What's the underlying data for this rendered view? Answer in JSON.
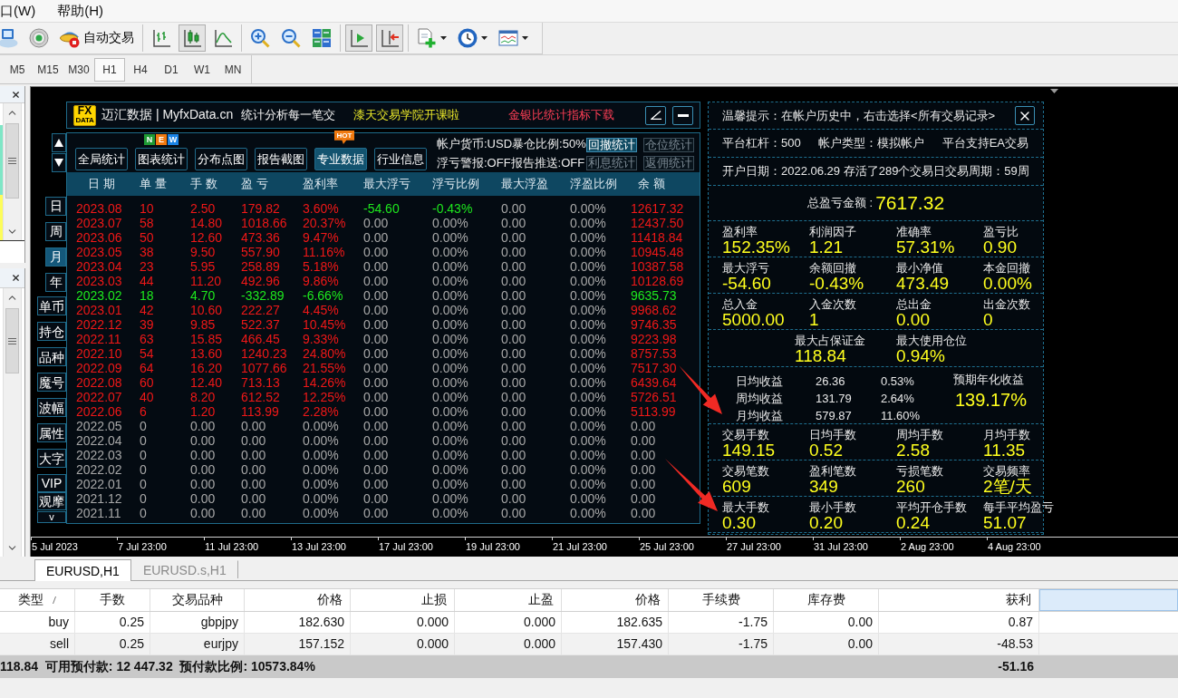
{
  "menu": [
    {
      "label": "口(W)"
    },
    {
      "label": "帮助(H)"
    }
  ],
  "toolbar": [
    [
      {
        "kind": "profiles",
        "on": false,
        "dropdown": false
      },
      {
        "kind": "signals",
        "on": false,
        "dropdown": false
      },
      {
        "kind": "auto-trade",
        "label": "自动交易",
        "on": false,
        "dropdown": false
      }
    ],
    [
      {
        "kind": "bar-chart",
        "on": false,
        "dropdown": false
      },
      {
        "kind": "candle-chart",
        "on": true,
        "dropdown": false
      },
      {
        "kind": "line-chart",
        "on": false,
        "dropdown": false
      }
    ],
    [
      {
        "kind": "zoom-in",
        "on": false,
        "dropdown": false
      },
      {
        "kind": "zoom-out",
        "on": false,
        "dropdown": false
      },
      {
        "kind": "tile",
        "on": false,
        "dropdown": false
      }
    ],
    [
      {
        "kind": "auto-scroll",
        "on": true,
        "dropdown": false
      },
      {
        "kind": "chart-shift",
        "on": true,
        "dropdown": false
      }
    ],
    [
      {
        "kind": "new-indicator",
        "on": false,
        "dropdown": true
      },
      {
        "kind": "periods",
        "on": false,
        "dropdown": true
      },
      {
        "kind": "templates",
        "on": false,
        "dropdown": true
      }
    ]
  ],
  "timeframes": [
    {
      "label": "M5",
      "selected": false
    },
    {
      "label": "M15",
      "selected": false
    },
    {
      "label": "M30",
      "selected": false
    },
    {
      "label": "H1",
      "selected": true
    },
    {
      "label": "H4",
      "selected": false
    },
    {
      "label": "D1",
      "selected": false
    },
    {
      "label": "W1",
      "selected": false
    },
    {
      "label": "MN",
      "selected": false
    }
  ],
  "stats_window": {
    "logo": {
      "top": "FX",
      "bottom": "DATA"
    },
    "brand": "迈汇数据 | MyfxData.cn",
    "slogan": "统计分析每一笔交",
    "promo": "漆天交易学院开课啦",
    "download": "金银比统计指标下载",
    "tabs": [
      {
        "label": "全局统计",
        "selected": false
      },
      {
        "label": "图表统计",
        "selected": false,
        "badge": {
          "kind": "letters",
          "letters": [
            {
              "text": "N",
              "color": "#1e9a34"
            },
            {
              "text": "E",
              "color": "#f07a10"
            },
            {
              "text": "W",
              "color": "#1a84e6"
            }
          ]
        }
      },
      {
        "label": "分布点图",
        "selected": false
      },
      {
        "label": "报告截图",
        "selected": false
      },
      {
        "label": "专业数据",
        "selected": true,
        "badge": {
          "kind": "tag",
          "text": "HOT"
        }
      },
      {
        "label": "行业信息",
        "selected": false
      }
    ],
    "settings": [
      "帐户货币:USD暴仓比例:50%",
      "浮亏警报:OFF报告推送:OFF"
    ],
    "report_buttons": [
      {
        "label": "回撤统计",
        "disabled": false
      },
      {
        "label": "仓位统计",
        "disabled": true
      },
      {
        "label": "利息统计",
        "disabled": true
      },
      {
        "label": "返佣统计",
        "disabled": true
      }
    ],
    "periods": [
      {
        "label": "日",
        "selected": false
      },
      {
        "label": "周",
        "selected": false
      },
      {
        "label": "月",
        "selected": true
      },
      {
        "label": "年",
        "selected": false
      }
    ],
    "filters": [
      "单币",
      "持仓",
      "品种",
      "魔号",
      "波幅",
      "属性",
      "大字"
    ],
    "extra_buttons": [
      "VIP",
      "观摩"
    ],
    "more": "v",
    "columns": [
      "日 期",
      "单 量",
      "手 数",
      "盈 亏",
      "盈利率",
      "最大浮亏",
      "浮亏比例",
      "最大浮盈",
      "浮盈比例",
      "余 额"
    ],
    "rows": [
      {
        "color": "#f01818",
        "cells": [
          "2023.08",
          "10",
          "2.50",
          "179.82",
          "3.60%"
        ],
        "float": {
          "color": "#1ee81e",
          "cells": [
            "-54.60",
            "-0.43%"
          ]
        },
        "peak": [
          "0.00",
          "0.00%"
        ],
        "balance": "12617.32"
      },
      {
        "color": "#f01818",
        "cells": [
          "2023.07",
          "58",
          "14.80",
          "1018.66",
          "20.37%"
        ],
        "float": {
          "color": "#a8a8a8",
          "cells": [
            "0.00",
            "0.00%"
          ]
        },
        "peak": [
          "0.00",
          "0.00%"
        ],
        "balance": "12437.50"
      },
      {
        "color": "#f01818",
        "cells": [
          "2023.06",
          "50",
          "12.60",
          "473.36",
          "9.47%"
        ],
        "float": {
          "color": "#a8a8a8",
          "cells": [
            "0.00",
            "0.00%"
          ]
        },
        "peak": [
          "0.00",
          "0.00%"
        ],
        "balance": "11418.84"
      },
      {
        "color": "#f01818",
        "cells": [
          "2023.05",
          "38",
          "9.50",
          "557.90",
          "11.16%"
        ],
        "float": {
          "color": "#a8a8a8",
          "cells": [
            "0.00",
            "0.00%"
          ]
        },
        "peak": [
          "0.00",
          "0.00%"
        ],
        "balance": "10945.48"
      },
      {
        "color": "#f01818",
        "cells": [
          "2023.04",
          "23",
          "5.95",
          "258.89",
          "5.18%"
        ],
        "float": {
          "color": "#a8a8a8",
          "cells": [
            "0.00",
            "0.00%"
          ]
        },
        "peak": [
          "0.00",
          "0.00%"
        ],
        "balance": "10387.58"
      },
      {
        "color": "#f01818",
        "cells": [
          "2023.03",
          "44",
          "11.20",
          "492.96",
          "9.86%"
        ],
        "float": {
          "color": "#a8a8a8",
          "cells": [
            "0.00",
            "0.00%"
          ]
        },
        "peak": [
          "0.00",
          "0.00%"
        ],
        "balance": "10128.69"
      },
      {
        "color": "#1ee81e",
        "cells": [
          "2023.02",
          "18",
          "4.70",
          "-332.89",
          "-6.66%"
        ],
        "float": {
          "color": "#a8a8a8",
          "cells": [
            "0.00",
            "0.00%"
          ]
        },
        "peak": [
          "0.00",
          "0.00%"
        ],
        "balance": "9635.73"
      },
      {
        "color": "#f01818",
        "cells": [
          "2023.01",
          "42",
          "10.60",
          "222.27",
          "4.45%"
        ],
        "float": {
          "color": "#a8a8a8",
          "cells": [
            "0.00",
            "0.00%"
          ]
        },
        "peak": [
          "0.00",
          "0.00%"
        ],
        "balance": "9968.62"
      },
      {
        "color": "#f01818",
        "cells": [
          "2022.12",
          "39",
          "9.85",
          "522.37",
          "10.45%"
        ],
        "float": {
          "color": "#a8a8a8",
          "cells": [
            "0.00",
            "0.00%"
          ]
        },
        "peak": [
          "0.00",
          "0.00%"
        ],
        "balance": "9746.35"
      },
      {
        "color": "#f01818",
        "cells": [
          "2022.11",
          "63",
          "15.85",
          "466.45",
          "9.33%"
        ],
        "float": {
          "color": "#a8a8a8",
          "cells": [
            "0.00",
            "0.00%"
          ]
        },
        "peak": [
          "0.00",
          "0.00%"
        ],
        "balance": "9223.98"
      },
      {
        "color": "#f01818",
        "cells": [
          "2022.10",
          "54",
          "13.60",
          "1240.23",
          "24.80%"
        ],
        "float": {
          "color": "#a8a8a8",
          "cells": [
            "0.00",
            "0.00%"
          ]
        },
        "peak": [
          "0.00",
          "0.00%"
        ],
        "balance": "8757.53"
      },
      {
        "color": "#f01818",
        "cells": [
          "2022.09",
          "64",
          "16.20",
          "1077.66",
          "21.55%"
        ],
        "float": {
          "color": "#a8a8a8",
          "cells": [
            "0.00",
            "0.00%"
          ]
        },
        "peak": [
          "0.00",
          "0.00%"
        ],
        "balance": "7517.30"
      },
      {
        "color": "#f01818",
        "cells": [
          "2022.08",
          "60",
          "12.40",
          "713.13",
          "14.26%"
        ],
        "float": {
          "color": "#a8a8a8",
          "cells": [
            "0.00",
            "0.00%"
          ]
        },
        "peak": [
          "0.00",
          "0.00%"
        ],
        "balance": "6439.64"
      },
      {
        "color": "#f01818",
        "cells": [
          "2022.07",
          "40",
          "8.20",
          "612.52",
          "12.25%"
        ],
        "float": {
          "color": "#a8a8a8",
          "cells": [
            "0.00",
            "0.00%"
          ]
        },
        "peak": [
          "0.00",
          "0.00%"
        ],
        "balance": "5726.51"
      },
      {
        "color": "#f01818",
        "cells": [
          "2022.06",
          "6",
          "1.20",
          "113.99",
          "2.28%"
        ],
        "float": {
          "color": "#a8a8a8",
          "cells": [
            "0.00",
            "0.00%"
          ]
        },
        "peak": [
          "0.00",
          "0.00%"
        ],
        "balance": "5113.99"
      },
      {
        "color": "#a8a8a8",
        "cells": [
          "2022.05",
          "0",
          "0.00",
          "0.00",
          "0.00%"
        ],
        "float": {
          "color": "#a8a8a8",
          "cells": [
            "0.00",
            "0.00%"
          ]
        },
        "peak": [
          "0.00",
          "0.00%"
        ],
        "balance": "0.00"
      },
      {
        "color": "#a8a8a8",
        "cells": [
          "2022.04",
          "0",
          "0.00",
          "0.00",
          "0.00%"
        ],
        "float": {
          "color": "#a8a8a8",
          "cells": [
            "0.00",
            "0.00%"
          ]
        },
        "peak": [
          "0.00",
          "0.00%"
        ],
        "balance": "0.00"
      },
      {
        "color": "#a8a8a8",
        "cells": [
          "2022.03",
          "0",
          "0.00",
          "0.00",
          "0.00%"
        ],
        "float": {
          "color": "#a8a8a8",
          "cells": [
            "0.00",
            "0.00%"
          ]
        },
        "peak": [
          "0.00",
          "0.00%"
        ],
        "balance": "0.00"
      },
      {
        "color": "#a8a8a8",
        "cells": [
          "2022.02",
          "0",
          "0.00",
          "0.00",
          "0.00%"
        ],
        "float": {
          "color": "#a8a8a8",
          "cells": [
            "0.00",
            "0.00%"
          ]
        },
        "peak": [
          "0.00",
          "0.00%"
        ],
        "balance": "0.00"
      },
      {
        "color": "#a8a8a8",
        "cells": [
          "2022.01",
          "0",
          "0.00",
          "0.00",
          "0.00%"
        ],
        "float": {
          "color": "#a8a8a8",
          "cells": [
            "0.00",
            "0.00%"
          ]
        },
        "peak": [
          "0.00",
          "0.00%"
        ],
        "balance": "0.00"
      },
      {
        "color": "#a8a8a8",
        "cells": [
          "2021.12",
          "0",
          "0.00",
          "0.00",
          "0.00%"
        ],
        "float": {
          "color": "#a8a8a8",
          "cells": [
            "0.00",
            "0.00%"
          ]
        },
        "peak": [
          "0.00",
          "0.00%"
        ],
        "balance": "0.00"
      },
      {
        "color": "#a8a8a8",
        "cells": [
          "2021.11",
          "0",
          "0.00",
          "0.00",
          "0.00%"
        ],
        "float": {
          "color": "#a8a8a8",
          "cells": [
            "0.00",
            "0.00%"
          ]
        },
        "peak": [
          "0.00",
          "0.00%"
        ],
        "balance": "0.00"
      }
    ]
  },
  "summary_panel": {
    "notice": "温馨提示：在帐户历史中，右击选择<所有交易记录>",
    "account": [
      "平台杠杆：500",
      "帐户类型：模拟帐户",
      "平台支持EA交易"
    ],
    "opened": "开户日期：2022.06.29 存活了289个交易日交易周期：59周",
    "total": {
      "label": "总盈亏金额 :",
      "value": "7617.32"
    },
    "sections": [
      {
        "kind": "grid",
        "items": [
          {
            "label": "盈利率",
            "value": "152.35%"
          },
          {
            "label": "利润因子",
            "value": "1.21"
          },
          {
            "label": "准确率",
            "value": "57.31%"
          },
          {
            "label": "盈亏比",
            "value": "0.90"
          }
        ]
      },
      {
        "kind": "grid",
        "items": [
          {
            "label": "最大浮亏",
            "value": "-54.60"
          },
          {
            "label": "余额回撤",
            "value": "-0.43%"
          },
          {
            "label": "最小净值",
            "value": "473.49"
          },
          {
            "label": "本金回撤",
            "value": "0.00%"
          }
        ]
      },
      {
        "kind": "grid",
        "items": [
          {
            "label": "总入金",
            "value": "5000.00"
          },
          {
            "label": "入金次数",
            "value": "1"
          },
          {
            "label": "总出金",
            "value": "0.00"
          },
          {
            "label": "出金次数",
            "value": "0"
          }
        ]
      },
      {
        "kind": "pair",
        "items": [
          {
            "label": "最大占保证金",
            "value": "118.84"
          },
          {
            "label": "最大使用仓位",
            "value": "0.94%"
          }
        ]
      },
      {
        "kind": "income",
        "rows": [
          {
            "label": "日均收益",
            "amount": "26.36",
            "percent": "0.53%"
          },
          {
            "label": "周均收益",
            "amount": "131.79",
            "percent": "2.64%"
          },
          {
            "label": "月均收益",
            "amount": "579.87",
            "percent": "11.60%"
          }
        ],
        "annual": {
          "label": "预期年化收益",
          "value": "139.17%"
        }
      },
      {
        "kind": "grid",
        "items": [
          {
            "label": "交易手数",
            "value": "149.15"
          },
          {
            "label": "日均手数",
            "value": "0.52"
          },
          {
            "label": "周均手数",
            "value": "2.58"
          },
          {
            "label": "月均手数",
            "value": "11.35"
          }
        ]
      },
      {
        "kind": "grid",
        "items": [
          {
            "label": "交易笔数",
            "value": "609"
          },
          {
            "label": "盈利笔数",
            "value": "349"
          },
          {
            "label": "亏损笔数",
            "value": "260"
          },
          {
            "label": "交易频率",
            "value": "2笔/天"
          }
        ]
      },
      {
        "kind": "grid",
        "items": [
          {
            "label": "最大手数",
            "value": "0.30"
          },
          {
            "label": "最小手数",
            "value": "0.20"
          },
          {
            "label": "平均开仓手数",
            "value": "0.24"
          },
          {
            "label": "每手平均盈亏",
            "value": "51.07"
          }
        ]
      }
    ]
  },
  "time_axis": [
    "5 Jul 2023",
    "7 Jul 23:00",
    "11 Jul 23:00",
    "13 Jul 23:00",
    "17 Jul 23:00",
    "19 Jul 23:00",
    "21 Jul 23:00",
    "25 Jul 23:00",
    "27 Jul 23:00",
    "31 Jul 23:00",
    "2 Aug 23:00",
    "4 Aug 23:00"
  ],
  "chart_tabs": [
    {
      "label": "EURUSD,H1",
      "selected": true
    },
    {
      "label": "EURUSD.s,H1",
      "selected": false
    }
  ],
  "orders": {
    "columns": [
      {
        "label": "类型",
        "sorted": true
      },
      {
        "label": "手数",
        "sorted": false
      },
      {
        "label": "交易品种",
        "sorted": false
      },
      {
        "label": "价格",
        "sorted": false
      },
      {
        "label": "止损",
        "sorted": false
      },
      {
        "label": "止盈",
        "sorted": false
      },
      {
        "label": "价格",
        "sorted": false
      },
      {
        "label": "手续费",
        "sorted": false
      },
      {
        "label": "库存费",
        "sorted": false
      },
      {
        "label": "获利",
        "sorted": false
      }
    ],
    "rows": [
      {
        "cells": [
          "buy",
          "0.25",
          "gbpjpy",
          "182.630",
          "0.000",
          "0.000",
          "182.635",
          "-1.75",
          "0.00",
          "0.87"
        ]
      },
      {
        "cells": [
          "sell",
          "0.25",
          "eurjpy",
          "157.152",
          "0.000",
          "0.000",
          "157.430",
          "-1.75",
          "0.00",
          "-48.53"
        ]
      }
    ],
    "summary": {
      "text": "118.84  可用预付款: 12 447.32  预付款比例: 10573.84%",
      "profit": "-51.16"
    }
  }
}
